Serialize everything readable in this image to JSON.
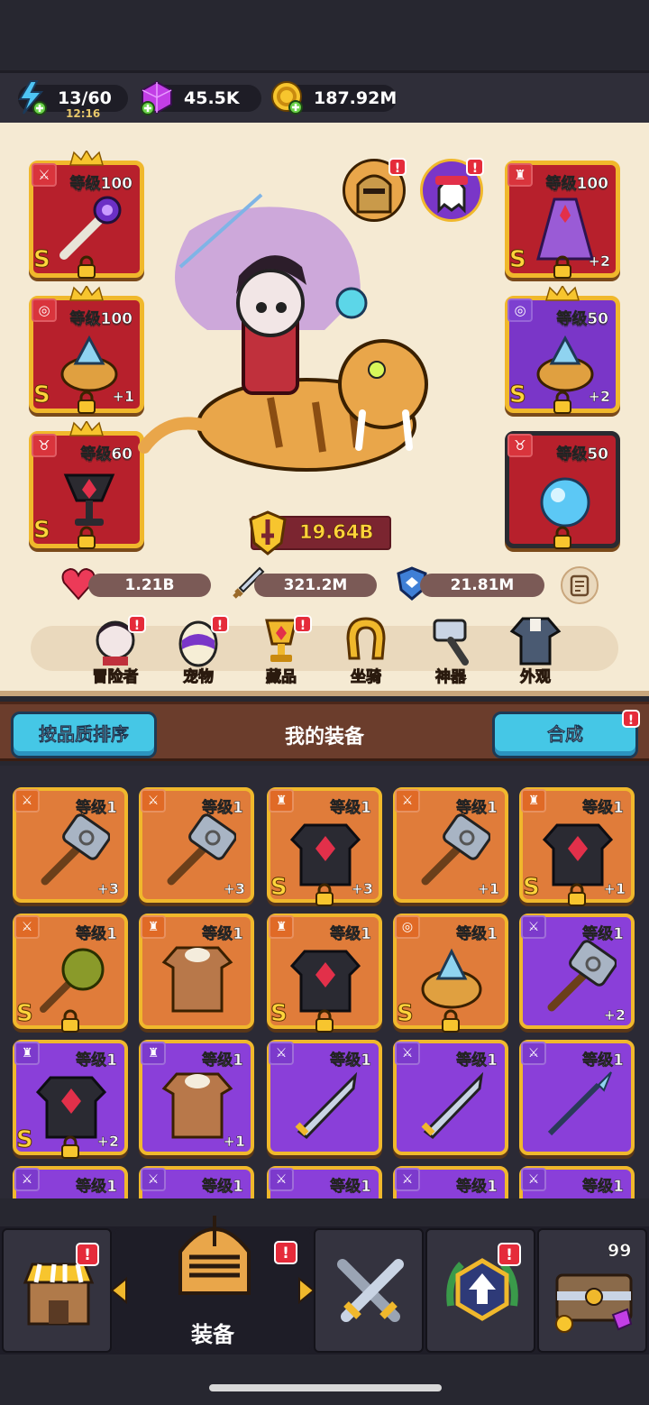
{
  "resources": {
    "energy": {
      "value": "13/60",
      "timer": "12:16",
      "icon": "lightning-icon"
    },
    "gems": {
      "value": "45.5K",
      "icon": "gem-icon"
    },
    "gold": {
      "value": "187.92M",
      "icon": "coin-icon"
    }
  },
  "hero": {
    "power": "19.64B",
    "stats": {
      "hp": "1.21B",
      "attack": "321.2M",
      "defense": "21.81M"
    },
    "left_slots": [
      {
        "level": "等级100",
        "grade": "S",
        "plus": "",
        "type": "weapon"
      },
      {
        "level": "等级100",
        "grade": "S",
        "plus": "+1",
        "type": "ring"
      },
      {
        "level": "等级60",
        "grade": "S",
        "plus": "",
        "type": "necklace"
      }
    ],
    "right_slots": [
      {
        "level": "等级100",
        "grade": "S",
        "plus": "+2",
        "type": "armor"
      },
      {
        "level": "等级50",
        "grade": "S",
        "plus": "+2",
        "type": "ring"
      },
      {
        "level": "等级50",
        "grade": "",
        "plus": "",
        "type": "necklace"
      }
    ],
    "badge": "!"
  },
  "tabs": [
    "冒险者",
    "宠物",
    "藏品",
    "坐骑",
    "神器",
    "外观"
  ],
  "equipment_header": {
    "sort_label": "按品质排序",
    "title": "我的装备",
    "merge_label": "合成"
  },
  "equipment_grid": [
    {
      "level": "等级1",
      "grade": "",
      "plus": "+3",
      "item": "hammer",
      "rarity": "orange"
    },
    {
      "level": "等级1",
      "grade": "",
      "plus": "+3",
      "item": "hammer",
      "rarity": "orange"
    },
    {
      "level": "等级1",
      "grade": "S",
      "plus": "+3",
      "item": "armor",
      "rarity": "orange"
    },
    {
      "level": "等级1",
      "grade": "",
      "plus": "+1",
      "item": "hammer",
      "rarity": "orange"
    },
    {
      "level": "等级1",
      "grade": "S",
      "plus": "+1",
      "item": "armor",
      "rarity": "orange"
    },
    {
      "level": "等级1",
      "grade": "S",
      "plus": "",
      "item": "mace",
      "rarity": "orange"
    },
    {
      "level": "等级1",
      "grade": "",
      "plus": "",
      "item": "tunic",
      "rarity": "orange"
    },
    {
      "level": "等级1",
      "grade": "S",
      "plus": "",
      "item": "armor",
      "rarity": "orange"
    },
    {
      "level": "等级1",
      "grade": "S",
      "plus": "",
      "item": "ring",
      "rarity": "orange"
    },
    {
      "level": "等级1",
      "grade": "",
      "plus": "+2",
      "item": "hammer",
      "rarity": "purple"
    },
    {
      "level": "等级1",
      "grade": "S",
      "plus": "+2",
      "item": "armor",
      "rarity": "purple"
    },
    {
      "level": "等级1",
      "grade": "",
      "plus": "+1",
      "item": "tunic",
      "rarity": "purple"
    },
    {
      "level": "等级1",
      "grade": "",
      "plus": "",
      "item": "sword",
      "rarity": "purple"
    },
    {
      "level": "等级1",
      "grade": "",
      "plus": "",
      "item": "sword",
      "rarity": "purple"
    },
    {
      "level": "等级1",
      "grade": "",
      "plus": "",
      "item": "spear",
      "rarity": "purple"
    },
    {
      "level": "等级1",
      "grade": "",
      "plus": "",
      "item": "bow",
      "rarity": "purple"
    },
    {
      "level": "等级1",
      "grade": "",
      "plus": "",
      "item": "staff",
      "rarity": "purple"
    },
    {
      "level": "等级1",
      "grade": "",
      "plus": "",
      "item": "sword",
      "rarity": "purple"
    },
    {
      "level": "等级1",
      "grade": "",
      "plus": "",
      "item": "sword",
      "rarity": "purple"
    },
    {
      "level": "等级1",
      "grade": "",
      "plus": "",
      "item": "sword",
      "rarity": "purple"
    }
  ],
  "bottom_nav": {
    "active_label": "装备",
    "chest_count": "99",
    "badge": "!"
  }
}
